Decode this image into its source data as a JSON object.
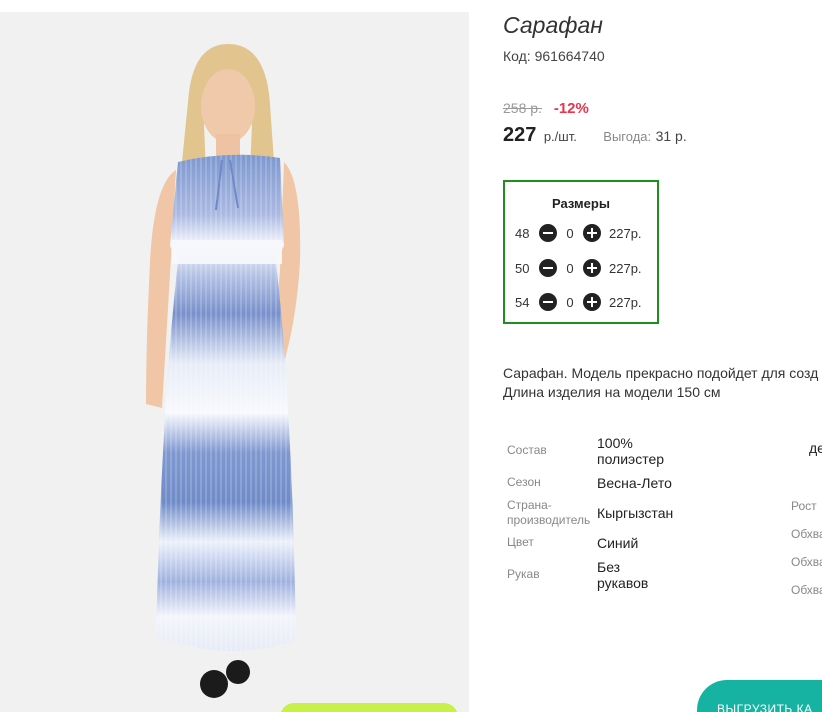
{
  "product": {
    "title": "Сарафан",
    "code": "Код: 961664740",
    "old_price": "258 р.",
    "discount": "-12%",
    "price": "227",
    "unit": "р./шт.",
    "save_label": "Выгода:",
    "save_value": "31 р."
  },
  "sizes": {
    "title": "Размеры",
    "rows": [
      {
        "size": "48",
        "qty": "0",
        "price": "227р."
      },
      {
        "size": "50",
        "qty": "0",
        "price": "227р."
      },
      {
        "size": "54",
        "qty": "0",
        "price": "227р."
      }
    ]
  },
  "description": {
    "line1": "Сарафан. Модель прекрасно подойдет для созд",
    "line2": "Длина изделия на модели 150 см"
  },
  "specs": {
    "composition_label": "Состав",
    "composition_value_1": "100%",
    "composition_value_2": "полиэстер",
    "season_label": "Сезон",
    "season_value": "Весна-Лето",
    "country_label_1": "Страна-",
    "country_label_2": "производитель",
    "country_value": "Кыргызстан",
    "color_label": "Цвет",
    "color_value": "Синий",
    "sleeve_label": "Рукав",
    "sleeve_value_1": "Без",
    "sleeve_value_2": "рукавов",
    "right_col_top": "де",
    "height_label": "Рост",
    "girth_label_1": "Обхва",
    "girth_label_2": "Обхва",
    "girth_label_3": "Обхва"
  },
  "actions": {
    "export_label": "выгрузить ка"
  },
  "colors": {
    "discount": "#e8344e",
    "sizes_border": "#1e8f1e",
    "cta_green": "#c8f04a",
    "cta_teal": "#16b3a2"
  }
}
